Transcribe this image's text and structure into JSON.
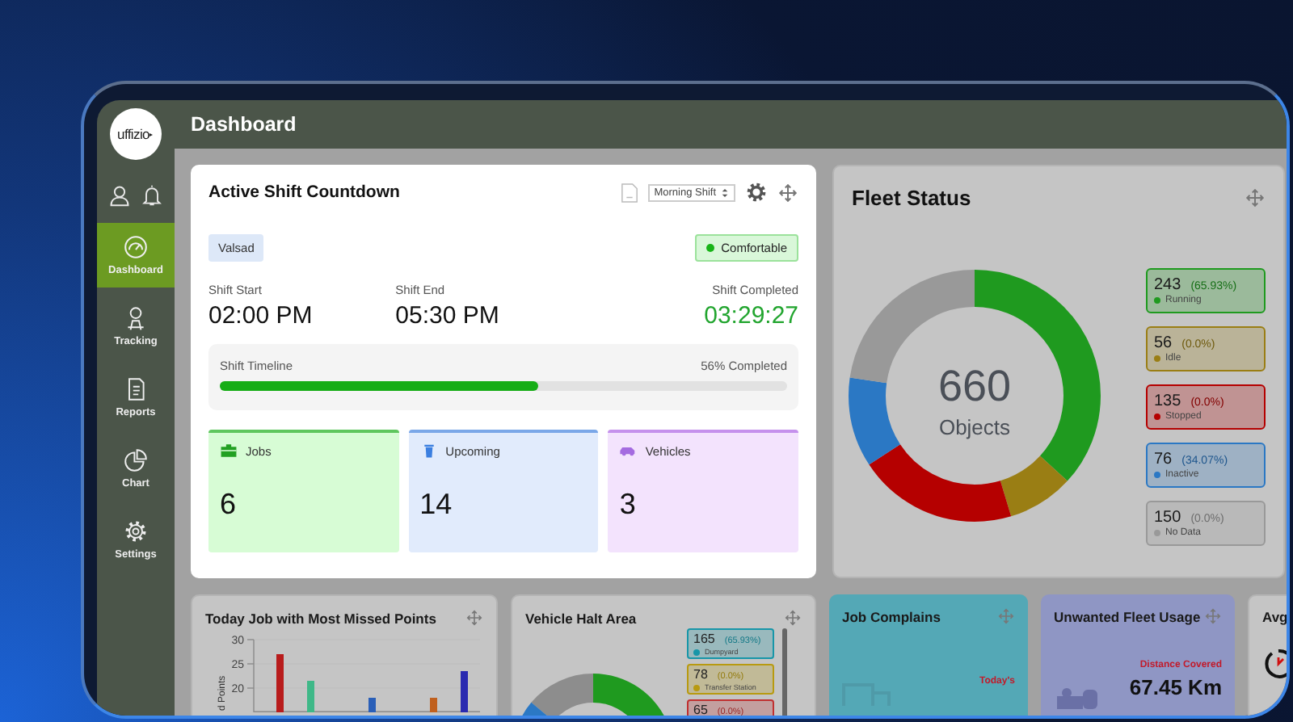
{
  "sidebar": {
    "logo": "uffizio",
    "items": [
      {
        "label": "Dashboard",
        "kind": "gauge",
        "selected": true
      },
      {
        "label": "Tracking",
        "kind": "tracking",
        "selected": false
      },
      {
        "label": "Reports",
        "kind": "reports",
        "selected": false
      },
      {
        "label": "Chart",
        "kind": "chart",
        "selected": false
      },
      {
        "label": "Settings",
        "kind": "settings",
        "selected": false
      }
    ]
  },
  "header": {
    "title": "Dashboard"
  },
  "shift_card": {
    "title": "Active Shift Countdown",
    "shift_select": "Morning Shift",
    "location": "Valsad",
    "status": "Comfortable",
    "times": [
      {
        "label": "Shift Start",
        "value": "02:00 PM",
        "kind": "plain"
      },
      {
        "label": "Shift End",
        "value": "05:30 PM",
        "kind": "plain"
      },
      {
        "label": "Shift Completed",
        "value": "03:29:27",
        "kind": "countdown"
      }
    ],
    "timeline": {
      "label": "Shift Timeline",
      "reading": "56% Completed",
      "level": 0.56
    },
    "stats": [
      {
        "label": "Jobs",
        "value": "6",
        "kind": "jobs"
      },
      {
        "label": "Upcoming",
        "value": "14",
        "kind": "upcoming"
      },
      {
        "label": "Vehicles",
        "value": "3",
        "kind": "vehicles"
      }
    ]
  },
  "fleet_status": {
    "title": "Fleet Status",
    "total": "660",
    "total_label": "Objects",
    "legend": [
      {
        "count": "243",
        "percent": "(65.93%)",
        "label": "Running",
        "color": "#1f9a1f"
      },
      {
        "count": "56",
        "percent": "(0.0%)",
        "label": "Idle",
        "color": "#9a7e14"
      },
      {
        "count": "135",
        "percent": "(0.0%)",
        "label": "Stopped",
        "color": "#b50000"
      },
      {
        "count": "76",
        "percent": "(34.07%)",
        "label": "Inactive",
        "color": "#2b78c4"
      },
      {
        "count": "150",
        "percent": "(0.0%)",
        "label": "No Data",
        "color": "#999999"
      }
    ]
  },
  "bottom_cards": [
    {
      "kind": "bar_chart",
      "title": "Today Job with Most Missed Points",
      "chart_data": {
        "type": "bar",
        "ylabel": "d Points",
        "categories": [
          null,
          null,
          null,
          null,
          null,
          null,
          null
        ],
        "values": [
          27,
          21.5,
          null,
          18,
          null,
          18,
          23.5
        ],
        "colors": [
          "#b81c1c",
          "#3fb888",
          null,
          "#2a5fb8",
          null,
          "#c0601e",
          "#2a2ab0"
        ],
        "ylim": [
          15,
          30
        ],
        "yticks": [
          {
            "value": 20,
            "label": "20"
          },
          {
            "value": 25,
            "label": "25"
          },
          {
            "value": 30,
            "label": "30"
          }
        ]
      }
    },
    {
      "kind": "halt",
      "title": "Vehicle Halt Area",
      "legend": [
        {
          "count": "165",
          "percent": "(65.93%)",
          "label": "Dumpyard",
          "color": "#1796a8"
        },
        {
          "count": "78",
          "percent": "(0.0%)",
          "label": "Transfer Station",
          "color": "#b89a10"
        },
        {
          "count": "65",
          "percent": "(0.0%)",
          "color": "#c03030"
        }
      ]
    },
    {
      "kind": "complaints",
      "title": "Job Complains",
      "caption": "Today's"
    },
    {
      "kind": "usage",
      "title": "Unwanted Fleet Usage",
      "caption": "Distance Covered",
      "value": "67.45 Km"
    },
    {
      "kind": "avg",
      "title": "Avg"
    }
  ]
}
